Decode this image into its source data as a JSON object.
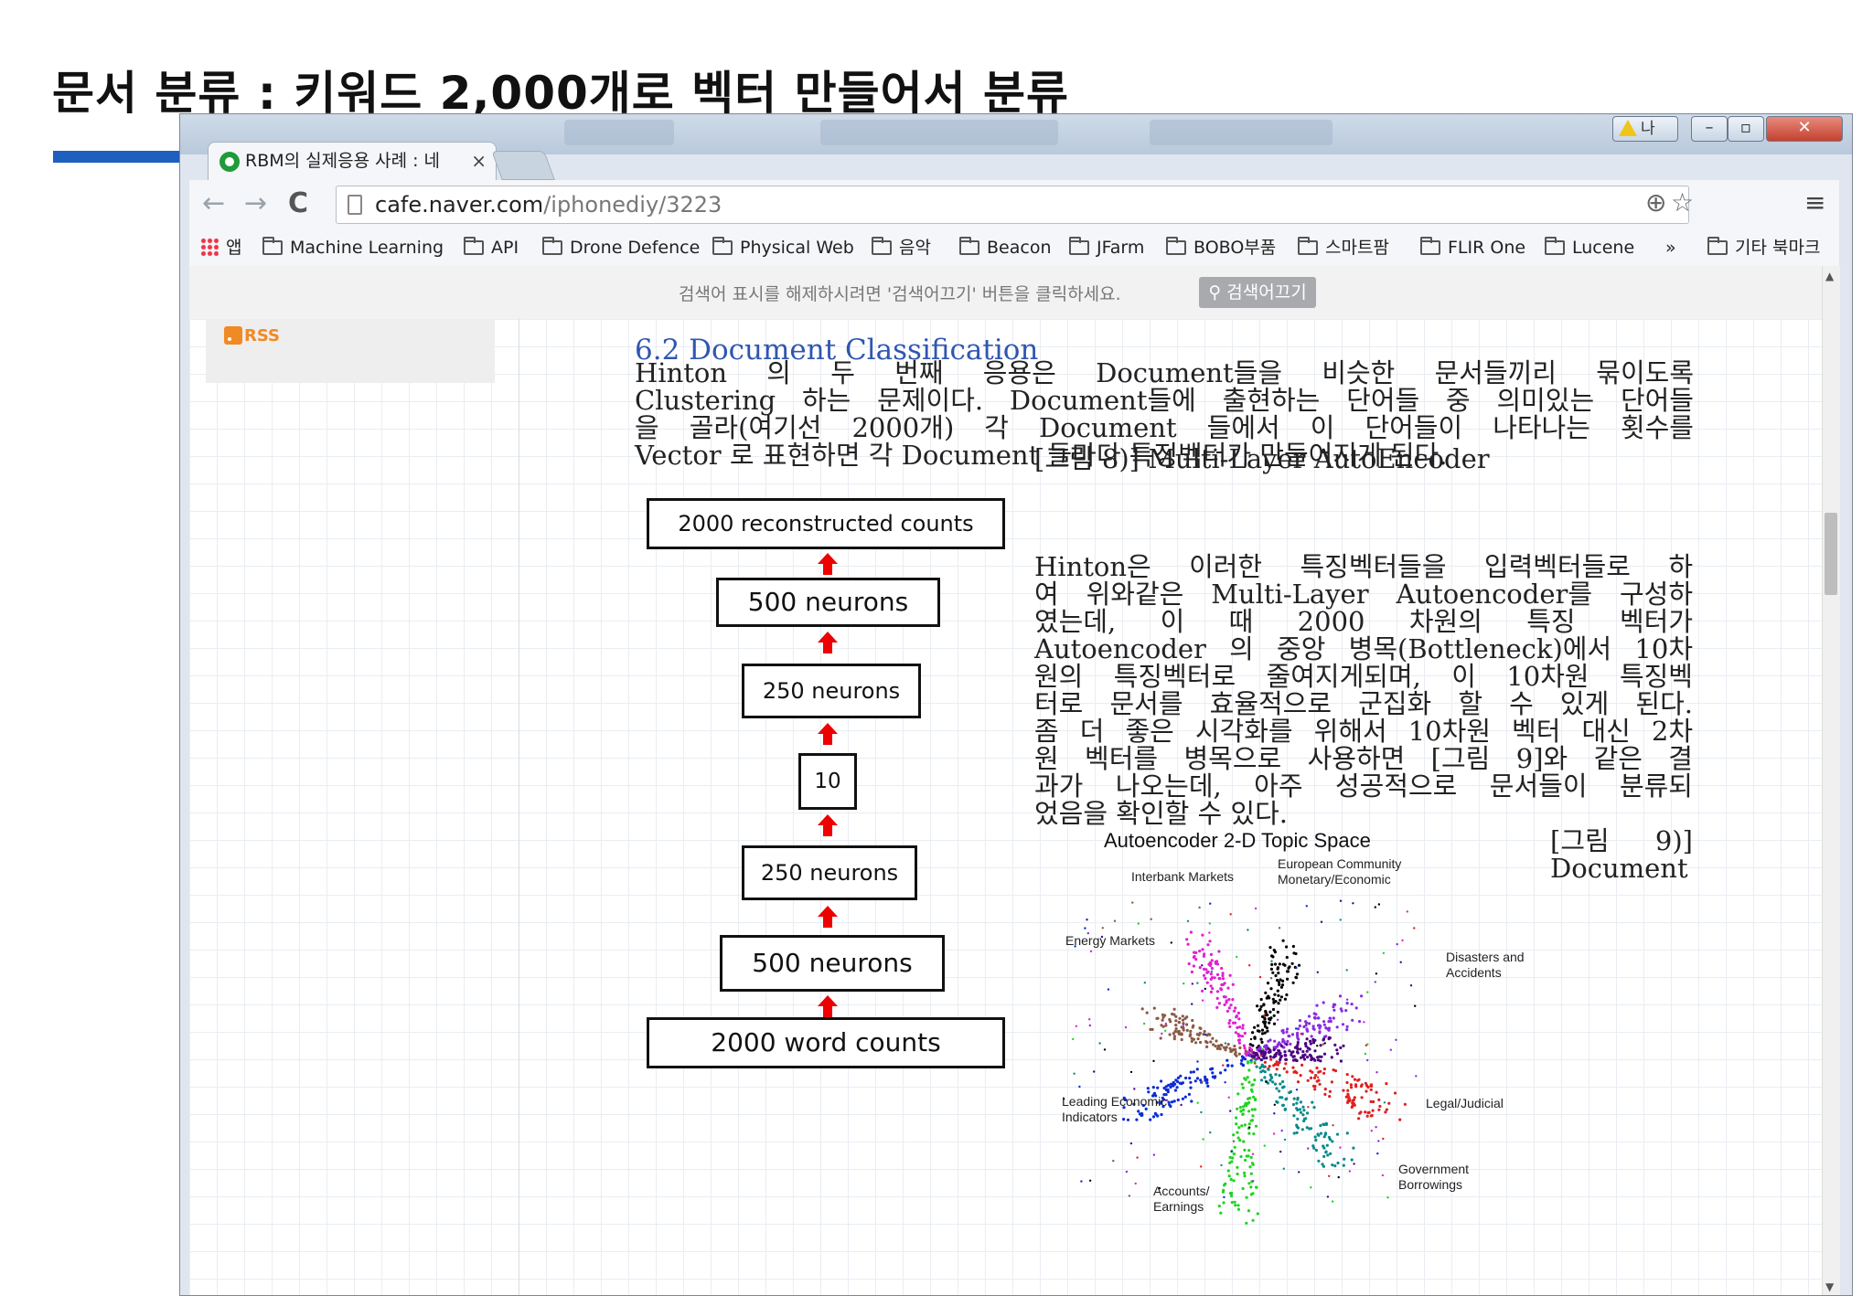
{
  "slide": {
    "title": "문서 분류 : 키워드 2,000개로 벡터 만들어서 분류"
  },
  "window": {
    "warning_label": "나",
    "minimize_icon": "minimize-icon",
    "maximize_icon": "maximize-icon",
    "close_icon": "close-icon"
  },
  "tab": {
    "title": "RBM의 실제응용 사례 : 네",
    "close": "×"
  },
  "toolbar": {
    "back": "←",
    "forward": "→",
    "reload": "C",
    "url_host": "cafe.naver.com",
    "url_path": "/iphonediy/3223",
    "zoom_icon": "⊕",
    "star_icon": "☆",
    "menu_icon": "≡"
  },
  "bookmarks": {
    "apps": "앱",
    "items": [
      "Machine Learning",
      "API",
      "Drone Defence",
      "Physical Web",
      "음악",
      "Beacon",
      "JFarm",
      "BOBO부품",
      "스마트팜",
      "FLIR One",
      "Lucene"
    ],
    "more": "»",
    "other": "기타 북마크"
  },
  "notice": {
    "text": "검색어 표시를 해제하시려면 '검색어끄기' 버튼을 클릭하세요.",
    "button": "검색어끄기"
  },
  "sidebar": {
    "rss": "RSS"
  },
  "article": {
    "heading": "6.2 Document Classification",
    "para1_lines": [
      "Hinton 의 두 번째 응용은 Document들을 비슷한 문서들끼리 묶이도록",
      "Clustering 하는 문제이다. Document들에 출현하는 단어들 중 의미있는 단어들",
      "을 골라(여기선 2000개) 각 Document 들에서 이 단어들이 나타나는 횟수를",
      "Vector 로 표현하면 각 Document 들마다 특징벡터가 만들어지게 된다."
    ],
    "caption8": "[그림 8)] Multi-Layer AutoEncoder",
    "para2_lines": [
      "Hinton은 이러한 특징벡터들을 입력벡터들로 하",
      "여 위와같은 Multi-Layer Autoencoder를 구성하",
      "였는데, 이 때 2000 차원의 특징 벡터가",
      "Autoencoder 의 중앙 병목(Bottleneck)에서 10차",
      "원의 특징벡터로 줄여지게되며, 이 10차원 특징벡",
      "터로 문서를 효율적으로 군집화 할 수 있게 된다.",
      "좀 더 좋은 시각화를 위해서 10차원 벡터 대신 2차",
      "원 벡터를 병목으로 사용하면 [그림 9]와 같은 결",
      "과가 나오는데, 아주 성공적으로 문서들이 분류되",
      "었음을 확인할 수 있다."
    ],
    "caption9_lines": [
      "[그림 9)]",
      "Document"
    ]
  },
  "diagram": {
    "layers": [
      "2000 reconstructed counts",
      "500 neurons",
      "250 neurons",
      "10",
      "250 neurons",
      "500 neurons",
      "2000 word counts"
    ],
    "arrow_color": "#e00000"
  },
  "scatter": {
    "title": "Autoencoder 2-D Topic Space",
    "labels": [
      "Interbank Markets",
      "European Community\nMonetary/Economic",
      "Energy Markets",
      "Disasters and\nAccidents",
      "Leading Economic\nIndicators",
      "Legal/Judicial",
      "Government\nBorrowings",
      "Accounts/\nEarnings"
    ],
    "cluster_colors": [
      "#000000",
      "#8a5a44",
      "#e020d0",
      "#0a2bd6",
      "#1fd41f",
      "#e02020",
      "#8a2be2",
      "#0a8a8a",
      "#4b0082"
    ]
  }
}
